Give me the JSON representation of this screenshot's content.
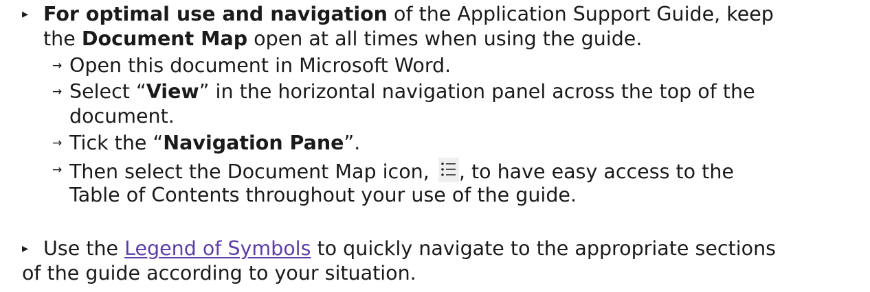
{
  "bullets": [
    {
      "lead_bold": "For optimal use and navigation",
      "text_1": " of the Application Support Guide, keep",
      "text_2": "the ",
      "bold_2": "Document Map",
      "text_3": " open at all times when using the guide.",
      "sub_items": [
        {
          "text": "Open this document in Microsoft Word."
        },
        {
          "pre": "Select “",
          "bold": "View",
          "post": "” in the horizontal navigation panel across the top of the",
          "line2": "document."
        },
        {
          "pre": "Tick the “",
          "bold": "Navigation Pane",
          "post": "”."
        },
        {
          "pre": "Then select the Document Map icon, ",
          "post": ", to have easy access to the",
          "line2": "Table of Contents throughout your use of the guide."
        }
      ]
    },
    {
      "pre": "Use the ",
      "link": "Legend of Symbols",
      "post": " to quickly navigate to the appropriate sections",
      "line2": "of the guide according to your situation."
    }
  ],
  "icons": {
    "main_bullet": "▸",
    "sub_arrow": "→",
    "document_map_icon": "list-icon"
  },
  "colors": {
    "text": "#1a1a1a",
    "link": "#5b3ea6"
  }
}
